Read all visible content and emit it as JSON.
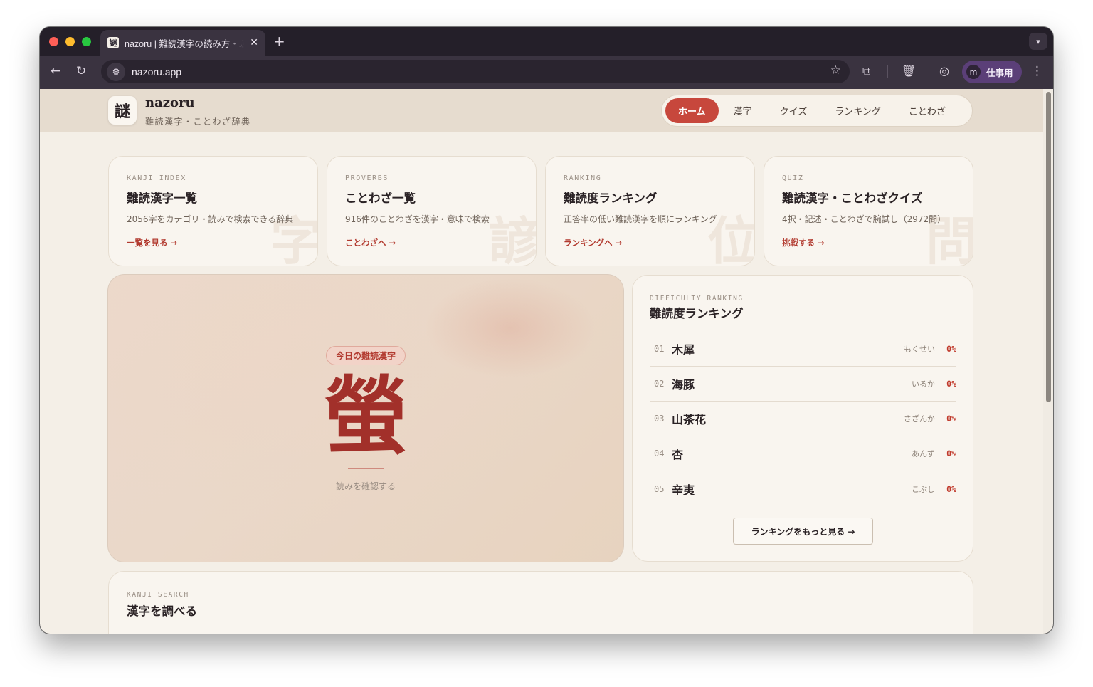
{
  "browser": {
    "tab_title": "nazoru | 難読漢字の読み方・ふりがな辞典",
    "tab_favicon": "謎",
    "tab_close": "✕",
    "new_tab": "+",
    "url": "nazoru.app",
    "profile_initial": "m",
    "profile_name": "仕事用"
  },
  "header": {
    "logo": "謎",
    "brand_name": "nazoru",
    "brand_sub": "難読漢字・ことわざ辞典",
    "nav": [
      {
        "label": "ホーム",
        "active": true
      },
      {
        "label": "漢字"
      },
      {
        "label": "クイズ"
      },
      {
        "label": "ランキング"
      },
      {
        "label": "ことわざ"
      }
    ]
  },
  "cards": [
    {
      "kicker": "KANJI INDEX",
      "title": "難読漢字一覧",
      "desc": "2056字をカテゴリ・読みで検索できる辞典",
      "link": "一覧を見る →",
      "watermark": "字"
    },
    {
      "kicker": "PROVERBS",
      "title": "ことわざ一覧",
      "desc": "916件のことわざを漢字・意味で検索",
      "link": "ことわざへ →",
      "watermark": "諺"
    },
    {
      "kicker": "RANKING",
      "title": "難読度ランキング",
      "desc": "正答率の低い難読漢字を順にランキング",
      "link": "ランキングへ →",
      "watermark": "位"
    },
    {
      "kicker": "QUIZ",
      "title": "難読漢字・ことわざクイズ",
      "desc": "4択・記述・ことわざで腕試し（2972問）",
      "link": "挑戦する →",
      "watermark": "問"
    }
  ],
  "hero": {
    "badge": "今日の難読漢字",
    "kanji": "螢",
    "hint": "読みを確認する"
  },
  "ranking": {
    "kicker": "DIFFICULTY RANKING",
    "title": "難読度ランキング",
    "items": [
      {
        "rank": "01",
        "word": "木犀",
        "reading": "もくせい",
        "pct": "0%"
      },
      {
        "rank": "02",
        "word": "海豚",
        "reading": "いるか",
        "pct": "0%"
      },
      {
        "rank": "03",
        "word": "山茶花",
        "reading": "さざんか",
        "pct": "0%"
      },
      {
        "rank": "04",
        "word": "杏",
        "reading": "あんず",
        "pct": "0%"
      },
      {
        "rank": "05",
        "word": "辛夷",
        "reading": "こぶし",
        "pct": "0%"
      }
    ],
    "more": "ランキングをもっと見る →"
  },
  "search": {
    "kicker": "KANJI SEARCH",
    "title": "漢字を調べる"
  },
  "colors": {
    "accent": "#c7473c",
    "accent_text": "#b23a2f",
    "page_bg": "#f4efe7",
    "header_bg": "#e6dccf"
  }
}
